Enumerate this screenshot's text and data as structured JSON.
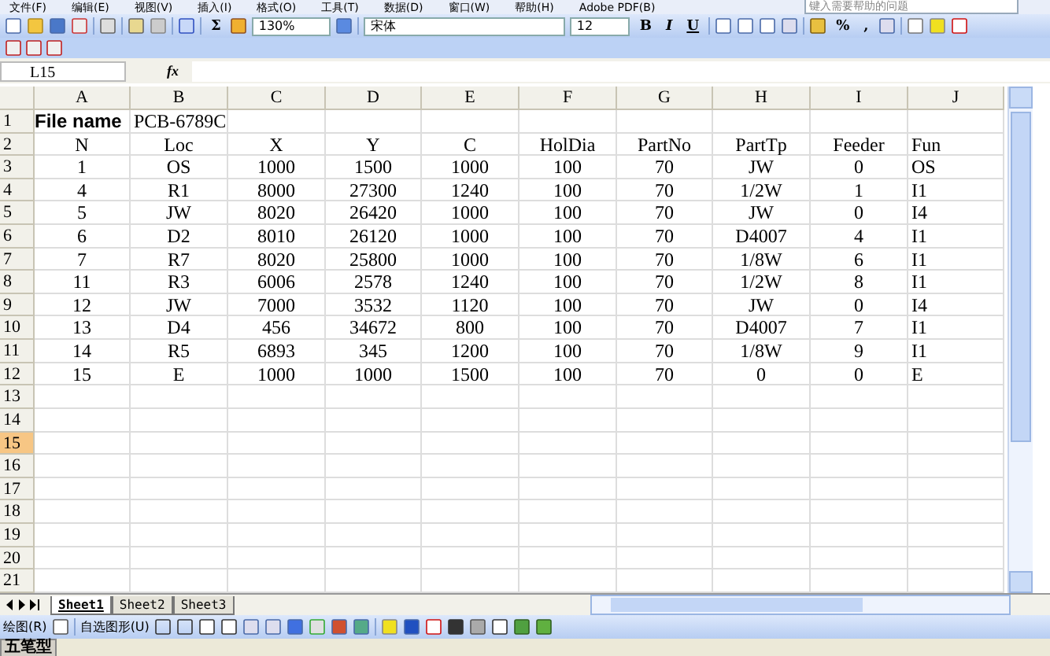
{
  "menu": {
    "items": [
      "文件(F)",
      "编辑(E)",
      "视图(V)",
      "插入(I)",
      "格式(O)",
      "工具(T)",
      "数据(D)",
      "窗口(W)",
      "帮助(H)",
      "Adobe PDF(B)"
    ],
    "help_placeholder": "键入需要帮助的问题"
  },
  "toolbar": {
    "sum": "Σ",
    "zoom": "130%",
    "font": "宋体",
    "size": "12",
    "format_buttons": [
      "B",
      "I",
      "U"
    ],
    "percent": "%",
    "comma": ","
  },
  "formula_bar": {
    "name_box": "L15",
    "fx": "fx"
  },
  "columns": [
    "A",
    "B",
    "C",
    "D",
    "E",
    "F",
    "G",
    "H",
    "I",
    "J"
  ],
  "rows": [
    {
      "number": "1",
      "selected": false,
      "cells": {
        "A": "File name",
        "B": "PCB-6789C"
      }
    },
    {
      "number": "2",
      "selected": false,
      "cells": {
        "A": "N",
        "B": "Loc",
        "C": "X",
        "D": "Y",
        "E": "C",
        "F": "HolDia",
        "G": "PartNo",
        "H": "PartTp",
        "I": "Feeder",
        "J": "Fun"
      }
    },
    {
      "number": "3",
      "selected": false,
      "cells": {
        "A": "1",
        "B": "OS",
        "C": "1000",
        "D": "1500",
        "E": "1000",
        "F": "100",
        "G": "70",
        "H": "JW",
        "I": "0",
        "J": "OS"
      }
    },
    {
      "number": "4",
      "selected": false,
      "cells": {
        "A": "4",
        "B": "R1",
        "C": "8000",
        "D": "27300",
        "E": "1240",
        "F": "100",
        "G": "70",
        "H": "1/2W",
        "I": "1",
        "J": "I1"
      }
    },
    {
      "number": "5",
      "selected": false,
      "cells": {
        "A": "5",
        "B": "JW",
        "C": "8020",
        "D": "26420",
        "E": "1000",
        "F": "100",
        "G": "70",
        "H": "JW",
        "I": "0",
        "J": "I4"
      }
    },
    {
      "number": "6",
      "selected": false,
      "cells": {
        "A": "6",
        "B": "D2",
        "C": "8010",
        "D": "26120",
        "E": "1000",
        "F": "100",
        "G": "70",
        "H": "D4007",
        "I": "4",
        "J": "I1"
      }
    },
    {
      "number": "7",
      "selected": false,
      "cells": {
        "A": "7",
        "B": "R7",
        "C": "8020",
        "D": "25800",
        "E": "1000",
        "F": "100",
        "G": "70",
        "H": "1/8W",
        "I": "6",
        "J": "I1"
      }
    },
    {
      "number": "8",
      "selected": false,
      "cells": {
        "A": "11",
        "B": "R3",
        "C": "6006",
        "D": "2578",
        "E": "1240",
        "F": "100",
        "G": "70",
        "H": "1/2W",
        "I": "8",
        "J": "I1"
      }
    },
    {
      "number": "9",
      "selected": false,
      "cells": {
        "A": "12",
        "B": "JW",
        "C": "7000",
        "D": "3532",
        "E": "1120",
        "F": "100",
        "G": "70",
        "H": "JW",
        "I": "0",
        "J": "I4"
      }
    },
    {
      "number": "10",
      "selected": false,
      "cells": {
        "A": "13",
        "B": "D4",
        "C": "456",
        "D": "34672",
        "E": "800",
        "F": "100",
        "G": "70",
        "H": "D4007",
        "I": "7",
        "J": "I1"
      }
    },
    {
      "number": "11",
      "selected": false,
      "cells": {
        "A": "14",
        "B": "R5",
        "C": "6893",
        "D": "345",
        "E": "1200",
        "F": "100",
        "G": "70",
        "H": "1/8W",
        "I": "9",
        "J": "I1"
      }
    },
    {
      "number": "12",
      "selected": false,
      "cells": {
        "A": "15",
        "B": "E",
        "C": "1000",
        "D": "1000",
        "E": "1500",
        "F": "100",
        "G": "70",
        "H": "0",
        "I": "0",
        "J": "E"
      }
    },
    {
      "number": "13",
      "selected": false,
      "cells": {}
    },
    {
      "number": "14",
      "selected": false,
      "cells": {}
    },
    {
      "number": "15",
      "selected": true,
      "cells": {}
    },
    {
      "number": "16",
      "selected": false,
      "cells": {}
    },
    {
      "number": "17",
      "selected": false,
      "cells": {}
    },
    {
      "number": "18",
      "selected": false,
      "cells": {}
    },
    {
      "number": "19",
      "selected": false,
      "cells": {}
    },
    {
      "number": "20",
      "selected": false,
      "cells": {}
    },
    {
      "number": "21",
      "selected": false,
      "cells": {}
    }
  ],
  "sheets": [
    {
      "label": "Sheet1",
      "selected": true
    },
    {
      "label": "Sheet2",
      "selected": false
    },
    {
      "label": "Sheet3",
      "selected": false
    }
  ],
  "drawing_toolbar": {
    "draw_menu": "绘图(R)",
    "autoshapes": "自选图形(U)"
  },
  "ime_bar": {
    "mode": "五笔型"
  }
}
